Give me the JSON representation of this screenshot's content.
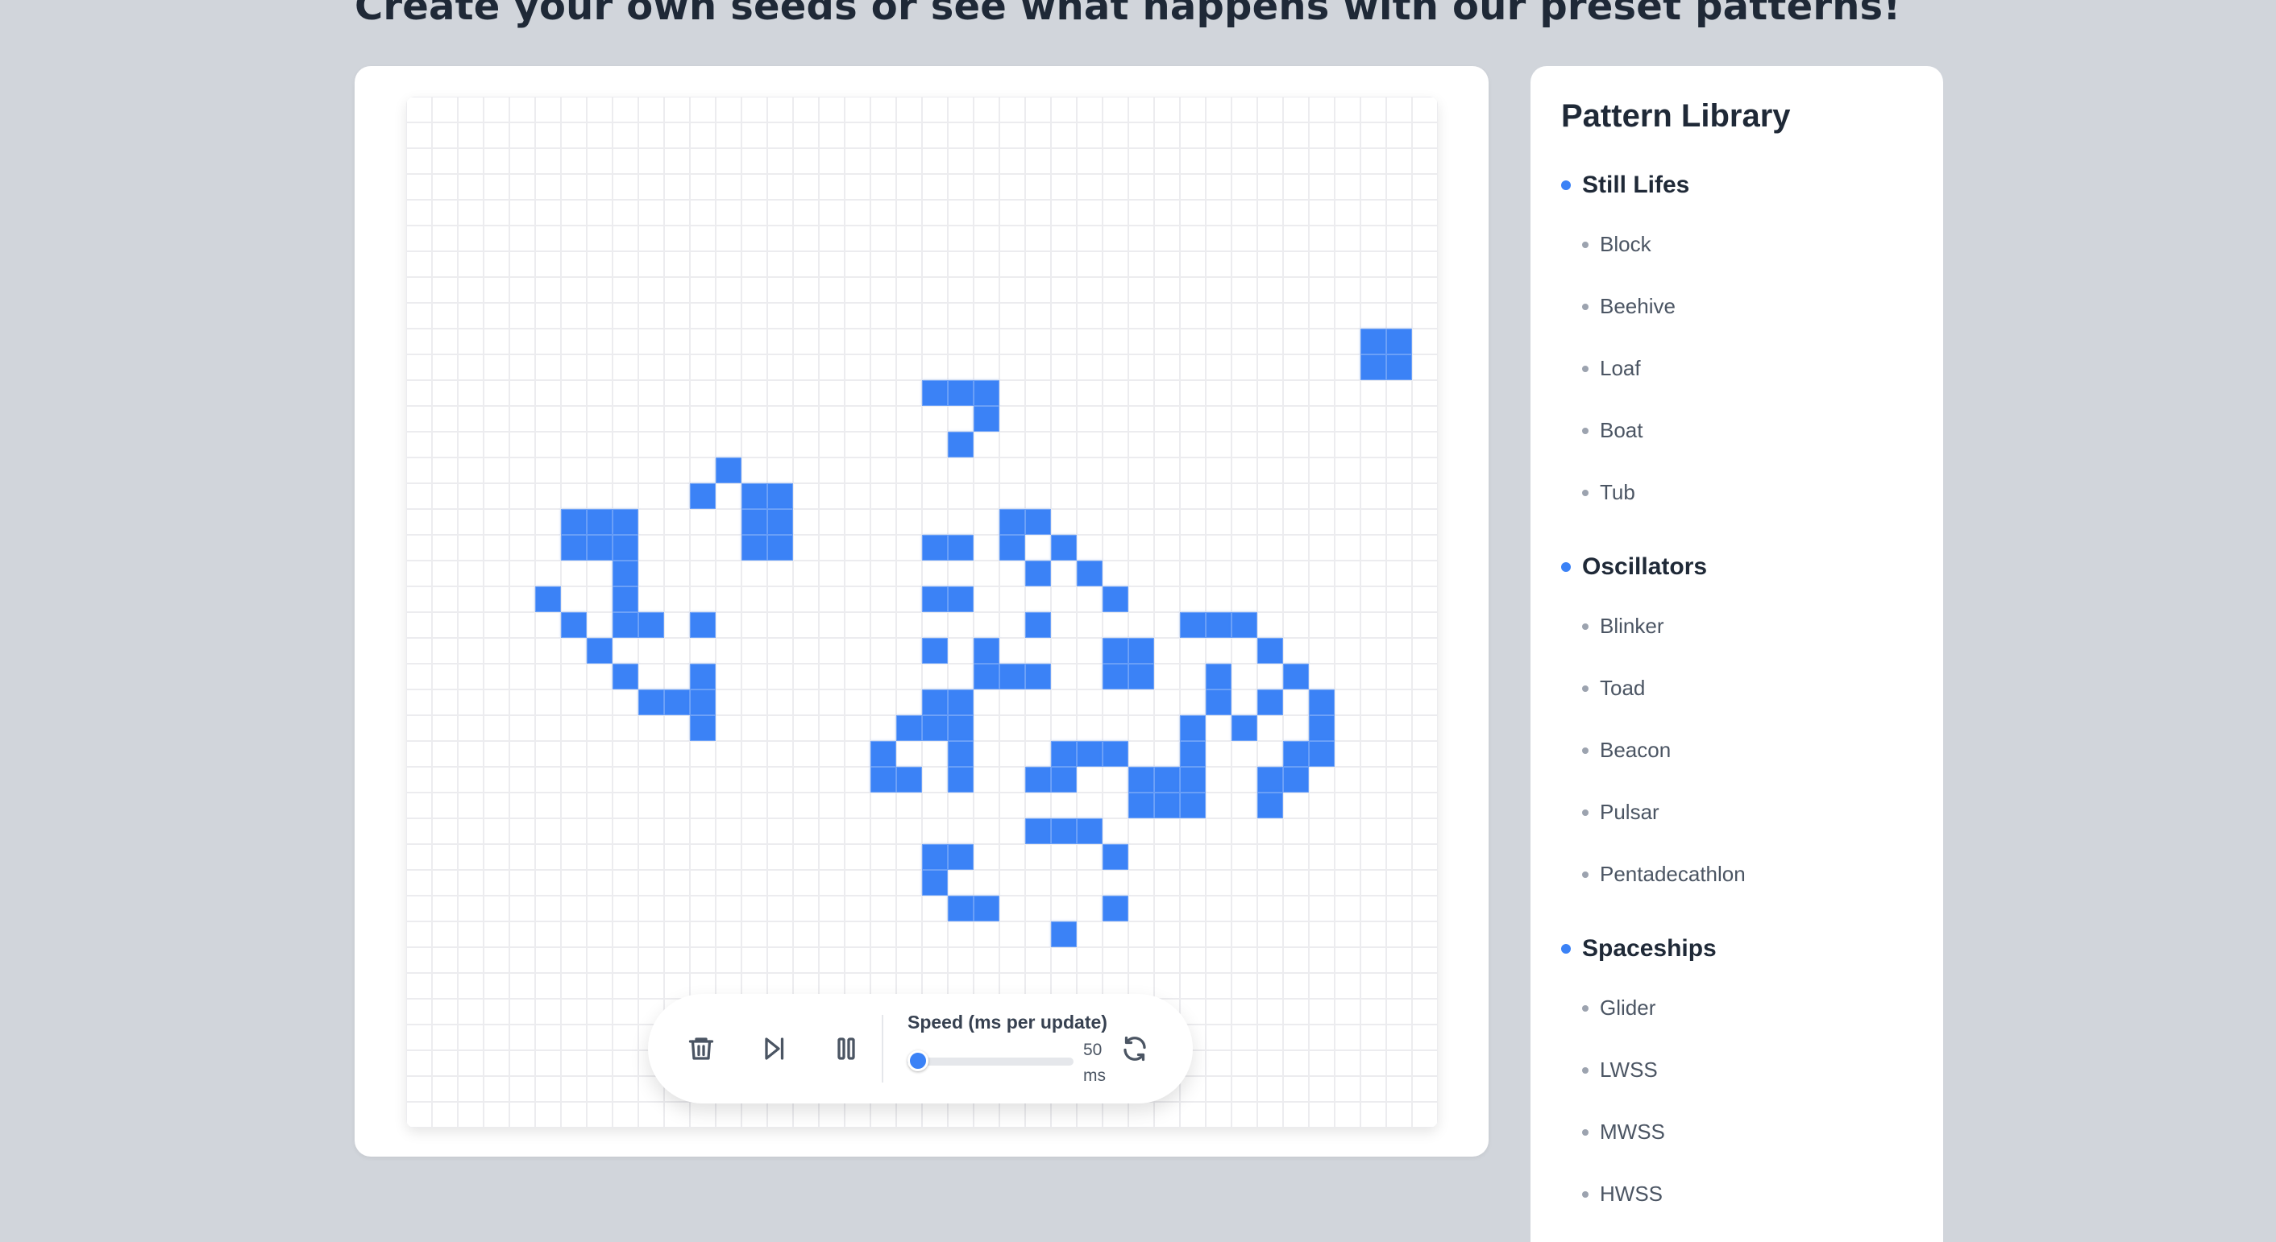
{
  "header": {
    "headline": "Create your own seeds or see what happens with our preset patterns!"
  },
  "board": {
    "rows": 40,
    "cols": 40,
    "alive_color": "#3b82f6",
    "alive_cells": [
      [
        9,
        37
      ],
      [
        9,
        38
      ],
      [
        10,
        37
      ],
      [
        10,
        38
      ],
      [
        11,
        20
      ],
      [
        11,
        21
      ],
      [
        11,
        22
      ],
      [
        12,
        22
      ],
      [
        13,
        21
      ],
      [
        14,
        12
      ],
      [
        15,
        11
      ],
      [
        15,
        13
      ],
      [
        15,
        14
      ],
      [
        16,
        6
      ],
      [
        16,
        7
      ],
      [
        16,
        8
      ],
      [
        16,
        13
      ],
      [
        16,
        14
      ],
      [
        16,
        23
      ],
      [
        16,
        24
      ],
      [
        17,
        6
      ],
      [
        17,
        7
      ],
      [
        17,
        8
      ],
      [
        17,
        13
      ],
      [
        17,
        14
      ],
      [
        17,
        20
      ],
      [
        17,
        21
      ],
      [
        17,
        23
      ],
      [
        17,
        25
      ],
      [
        18,
        8
      ],
      [
        18,
        24
      ],
      [
        18,
        26
      ],
      [
        19,
        5
      ],
      [
        19,
        8
      ],
      [
        19,
        20
      ],
      [
        19,
        21
      ],
      [
        19,
        27
      ],
      [
        20,
        6
      ],
      [
        20,
        8
      ],
      [
        20,
        9
      ],
      [
        20,
        11
      ],
      [
        20,
        24
      ],
      [
        20,
        30
      ],
      [
        20,
        31
      ],
      [
        20,
        32
      ],
      [
        21,
        7
      ],
      [
        21,
        20
      ],
      [
        21,
        22
      ],
      [
        21,
        27
      ],
      [
        21,
        28
      ],
      [
        21,
        33
      ],
      [
        22,
        8
      ],
      [
        22,
        11
      ],
      [
        22,
        22
      ],
      [
        22,
        23
      ],
      [
        22,
        24
      ],
      [
        22,
        27
      ],
      [
        22,
        28
      ],
      [
        22,
        31
      ],
      [
        22,
        34
      ],
      [
        23,
        9
      ],
      [
        23,
        10
      ],
      [
        23,
        11
      ],
      [
        23,
        20
      ],
      [
        23,
        21
      ],
      [
        23,
        31
      ],
      [
        23,
        33
      ],
      [
        23,
        35
      ],
      [
        24,
        11
      ],
      [
        24,
        19
      ],
      [
        24,
        20
      ],
      [
        24,
        21
      ],
      [
        24,
        30
      ],
      [
        24,
        32
      ],
      [
        24,
        35
      ],
      [
        25,
        18
      ],
      [
        25,
        21
      ],
      [
        25,
        25
      ],
      [
        25,
        26
      ],
      [
        25,
        27
      ],
      [
        25,
        30
      ],
      [
        25,
        34
      ],
      [
        25,
        35
      ],
      [
        26,
        18
      ],
      [
        26,
        19
      ],
      [
        26,
        21
      ],
      [
        26,
        24
      ],
      [
        26,
        25
      ],
      [
        26,
        28
      ],
      [
        26,
        29
      ],
      [
        26,
        30
      ],
      [
        26,
        33
      ],
      [
        26,
        34
      ],
      [
        27,
        28
      ],
      [
        27,
        29
      ],
      [
        27,
        30
      ],
      [
        27,
        33
      ],
      [
        28,
        24
      ],
      [
        28,
        25
      ],
      [
        28,
        26
      ],
      [
        29,
        20
      ],
      [
        29,
        21
      ],
      [
        29,
        27
      ],
      [
        30,
        20
      ],
      [
        31,
        21
      ],
      [
        31,
        22
      ],
      [
        31,
        27
      ],
      [
        32,
        25
      ]
    ]
  },
  "controls": {
    "clear_icon": "trash-icon",
    "step_icon": "skip-forward-icon",
    "pause_icon": "pause-icon",
    "reset_icon": "refresh-icon",
    "speed_label": "Speed (ms per update)",
    "speed_value": 50,
    "speed_value_text": "50",
    "speed_unit": "ms",
    "speed_fraction": 0.0
  },
  "library": {
    "title": "Pattern Library",
    "sections": [
      {
        "label": "Still Lifes",
        "items": [
          "Block",
          "Beehive",
          "Loaf",
          "Boat",
          "Tub"
        ]
      },
      {
        "label": "Oscillators",
        "items": [
          "Blinker",
          "Toad",
          "Beacon",
          "Pulsar",
          "Pentadecathlon"
        ]
      },
      {
        "label": "Spaceships",
        "items": [
          "Glider",
          "LWSS",
          "MWSS",
          "HWSS"
        ]
      }
    ]
  }
}
